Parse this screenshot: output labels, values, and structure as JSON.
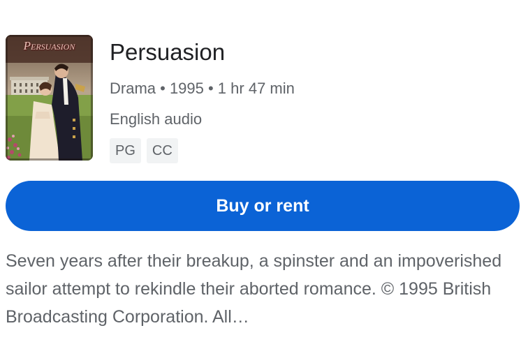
{
  "movie": {
    "title": "Persuasion",
    "poster_title": "Persuasion",
    "meta": "Drama • 1995 • 1 hr 47 min",
    "audio": "English audio",
    "badges": [
      "PG",
      "CC"
    ],
    "description": "Seven years after their breakup, a spinster and an impoverished sailor attempt to rekindle their aborted romance. © 1995 British Broadcasting Corporation. All…"
  },
  "actions": {
    "primary_label": "Buy or rent"
  },
  "colors": {
    "accent": "#0b63d6",
    "badge_bg": "#f1f3f4",
    "secondary_text": "#5f6368"
  }
}
